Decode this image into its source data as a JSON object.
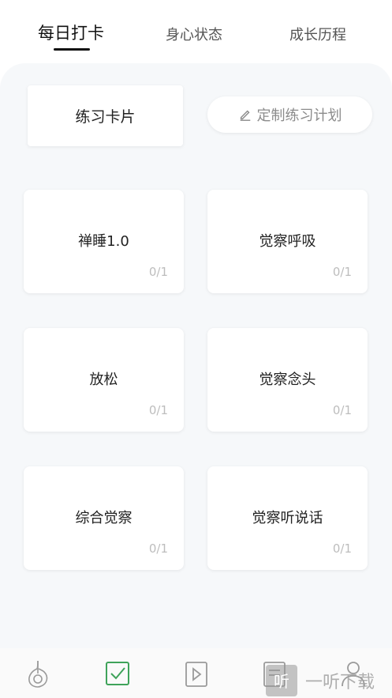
{
  "top_tabs": [
    {
      "label": "每日打卡"
    },
    {
      "label": "身心状态"
    },
    {
      "label": "成长历程"
    }
  ],
  "practice_card_label": "练习卡片",
  "custom_plan_label": "定制练习计划",
  "exercises": [
    {
      "title": "禅睡1.0",
      "progress": "0/1"
    },
    {
      "title": "觉察呼吸",
      "progress": "0/1"
    },
    {
      "title": "放松",
      "progress": "0/1"
    },
    {
      "title": "觉察念头",
      "progress": "0/1"
    },
    {
      "title": "综合觉察",
      "progress": "0/1"
    },
    {
      "title": "觉察听说话",
      "progress": "0/1"
    }
  ],
  "bottom_nav": [
    {
      "icon": "leaf-icon"
    },
    {
      "icon": "checkbox-icon",
      "active": true
    },
    {
      "icon": "play-icon"
    },
    {
      "icon": "document-icon"
    },
    {
      "icon": "user-icon"
    }
  ],
  "watermark": {
    "badge": "听",
    "text": "一听下载"
  },
  "colors": {
    "accent": "#3fa35a",
    "panel_bg": "#f6f8fa",
    "muted": "#bdbdbd"
  }
}
